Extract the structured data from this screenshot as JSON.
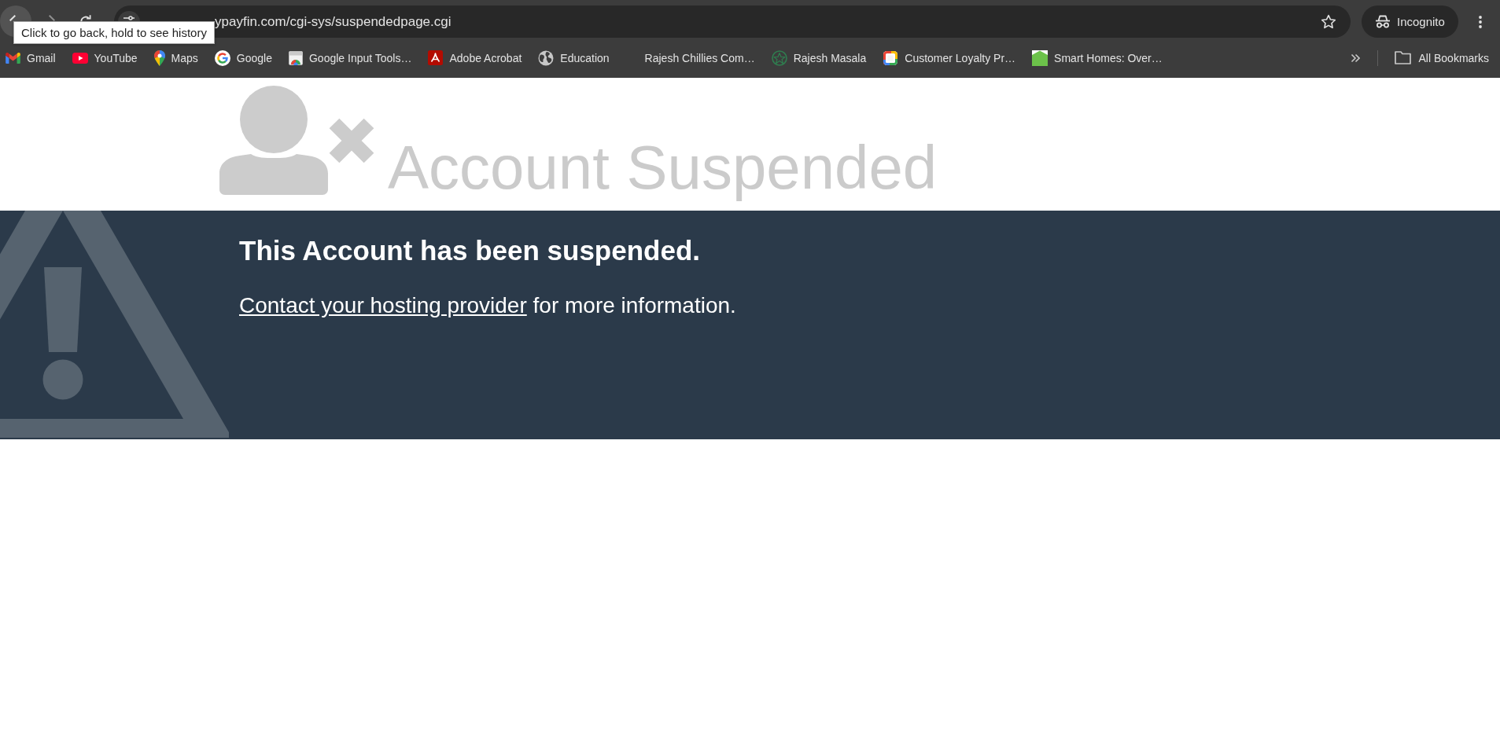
{
  "toolbar": {
    "url": "ypayfin.com/cgi-sys/suspendedpage.cgi",
    "profile": {
      "label": "Incognito"
    },
    "tooltip": {
      "text": "Click to go back, hold to see history"
    }
  },
  "bookmarks_bar": {
    "items": [
      {
        "label": "Gmail",
        "kind": "mail"
      },
      {
        "label": "YouTube",
        "kind": "play"
      },
      {
        "label": "Maps",
        "kind": "pin"
      },
      {
        "label": "Google",
        "kind": "g"
      },
      {
        "label": "Google Input Tools…",
        "kind": "page"
      },
      {
        "label": "Adobe Acrobat",
        "kind": "pdf"
      },
      {
        "label": "Education",
        "kind": "globe"
      },
      {
        "label": "Rajesh Chillies Com…",
        "kind": "blank"
      },
      {
        "label": "Rajesh Masala",
        "kind": "emblem"
      },
      {
        "label": "Customer Loyalty Pr…",
        "kind": "tile"
      },
      {
        "label": "Smart Homes: Over…",
        "kind": "house"
      }
    ],
    "all_bookmarks": {
      "label": "All Bookmarks"
    }
  },
  "page": {
    "title": "Account Suspended",
    "banner": {
      "heading": "This Account has been suspended.",
      "link": "Contact your hosting provider",
      "text": "for more information."
    }
  }
}
